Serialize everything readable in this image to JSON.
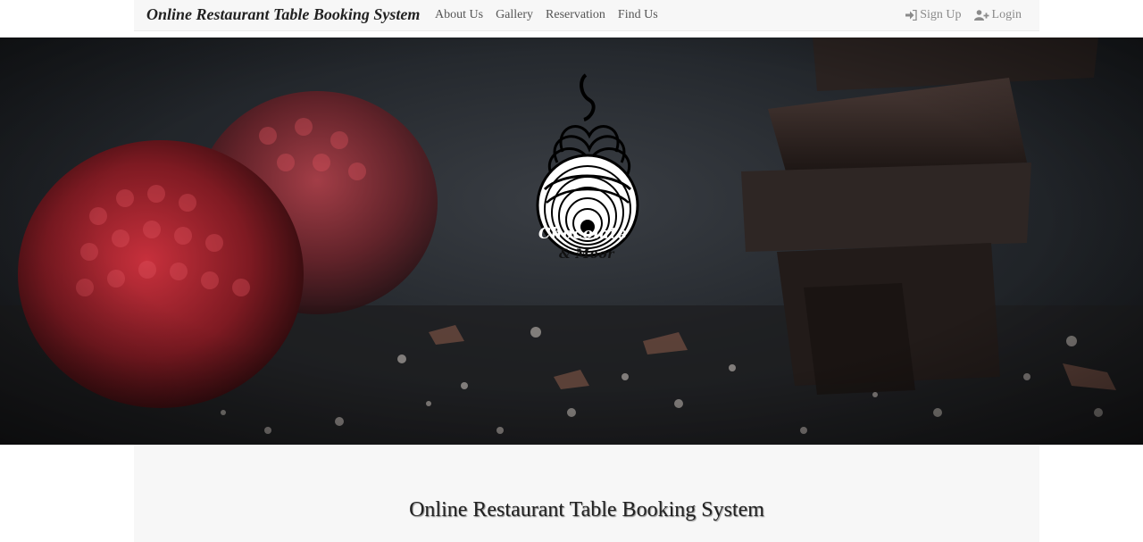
{
  "navbar": {
    "brand": "Online Restaurant Table Booking System",
    "links": [
      "About Us",
      "Gallery",
      "Reservation",
      "Find Us"
    ],
    "signup_label": "Sign Up",
    "login_label": "Login"
  },
  "hero": {
    "logo_line1": "Chocolate",
    "logo_line2": "& Moor"
  },
  "content": {
    "heading": "Online Restaurant Table Booking System"
  },
  "icons": {
    "signup": "sign-in-icon",
    "login": "user-plus-icon"
  }
}
